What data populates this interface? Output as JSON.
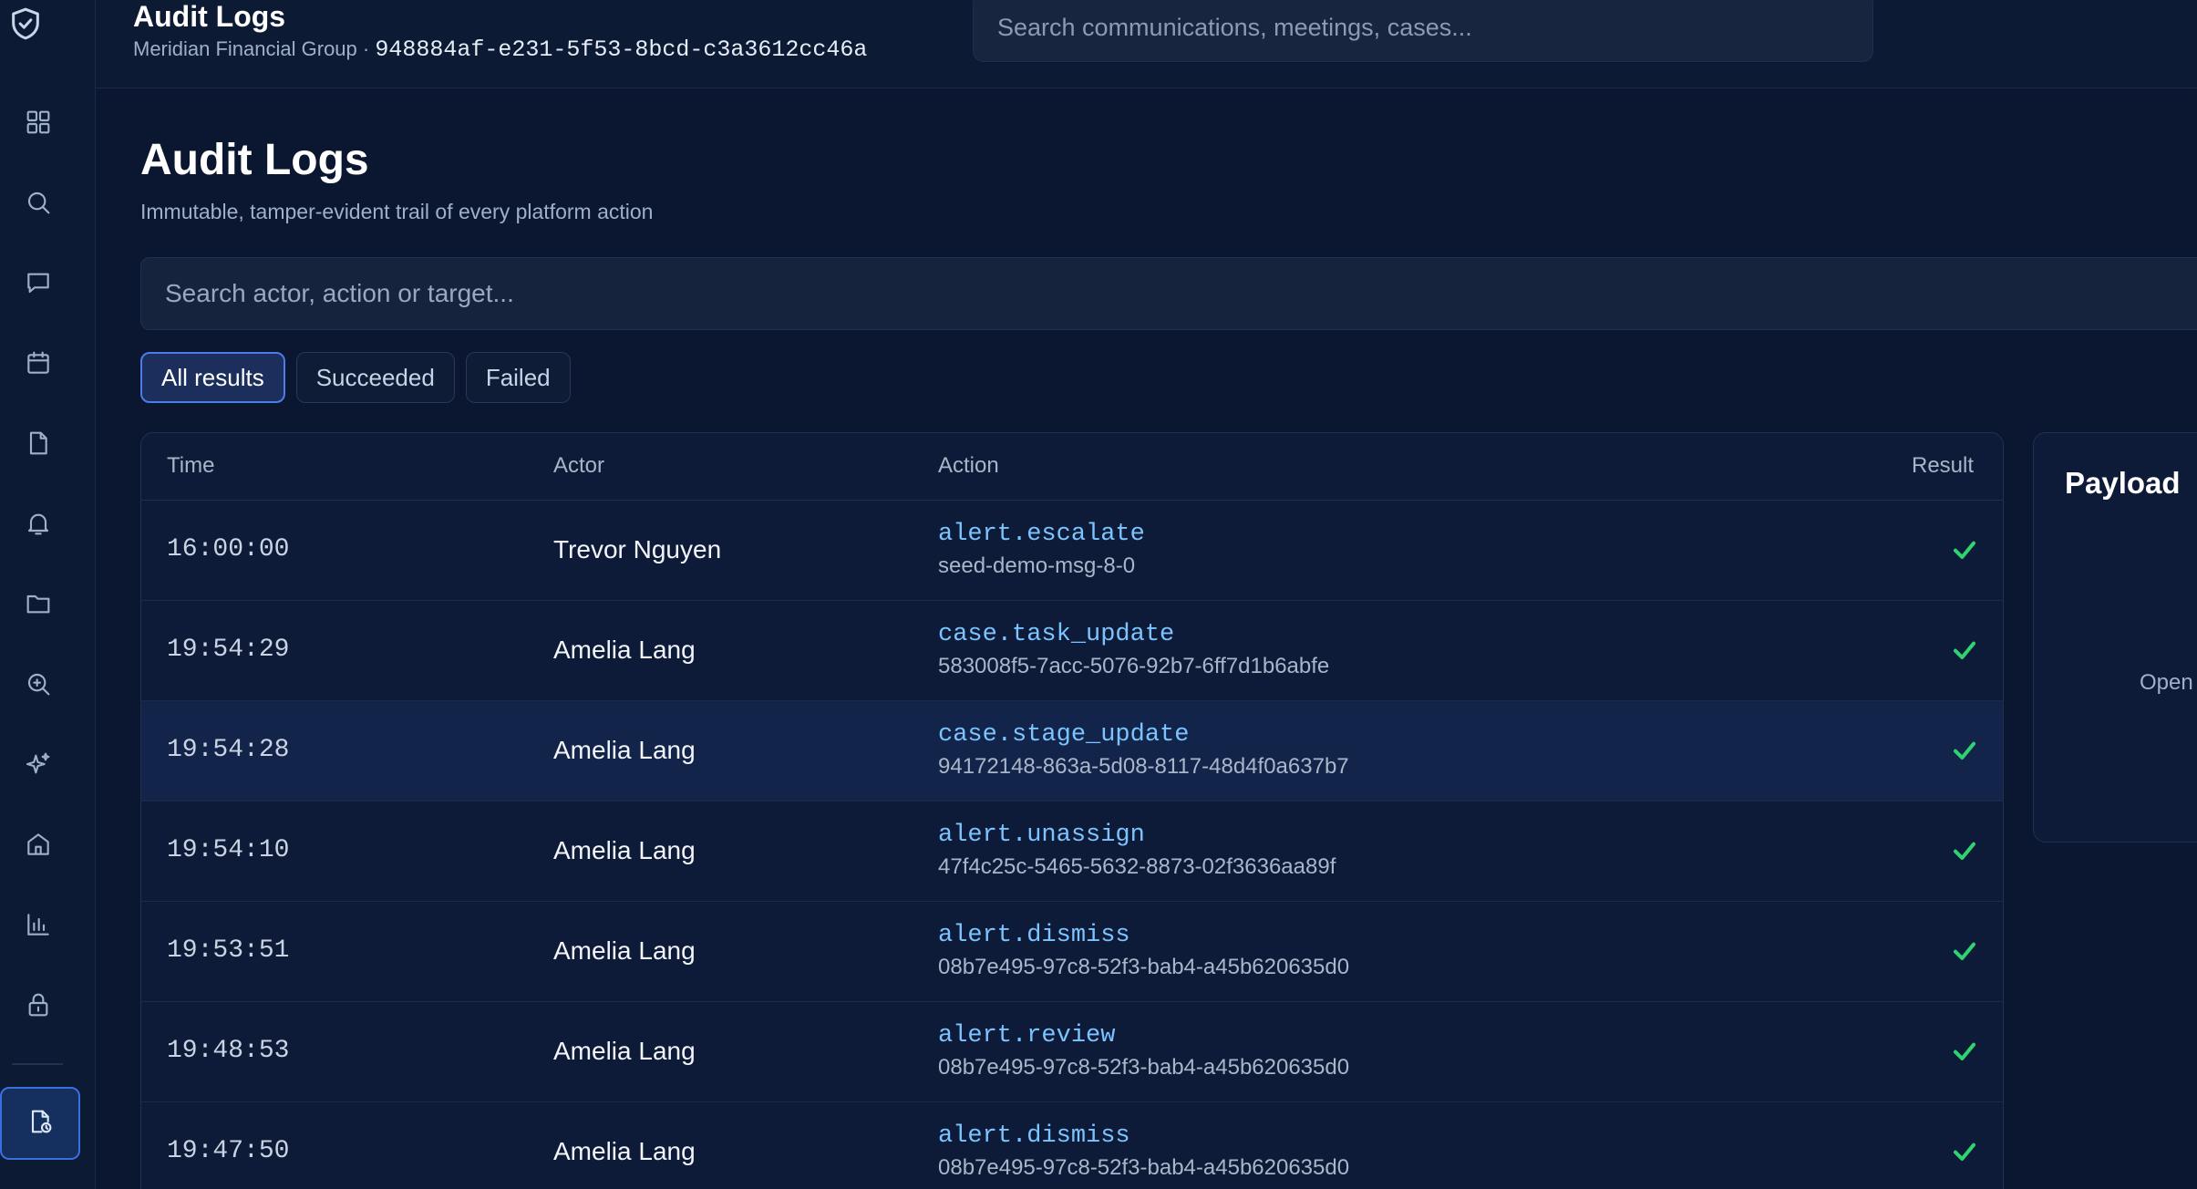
{
  "app": {
    "page_title": "Audit Logs",
    "org_name": "Meridian Financial Group",
    "org_separator": " · ",
    "org_id": "948884af-e231-5f53-8bcd-c3a3612cc46a"
  },
  "top_search": {
    "placeholder": "Search communications, meetings, cases..."
  },
  "sidebar": {
    "logo_icon": "shield-check-icon",
    "items": [
      {
        "icon": "dashboard-grid-icon"
      },
      {
        "icon": "search-icon"
      },
      {
        "icon": "chat-bubble-icon"
      },
      {
        "icon": "calendar-icon"
      },
      {
        "icon": "document-icon"
      },
      {
        "icon": "bell-icon"
      },
      {
        "icon": "folder-icon"
      },
      {
        "icon": "zoom-in-icon"
      },
      {
        "icon": "sparkles-icon"
      },
      {
        "icon": "home-icon"
      },
      {
        "icon": "bar-chart-icon"
      },
      {
        "icon": "lock-icon"
      }
    ],
    "active_item": {
      "icon": "audit-document-icon"
    }
  },
  "main": {
    "title": "Audit Logs",
    "subtitle": "Immutable, tamper-evident trail of every platform action",
    "search_placeholder": "Search actor, action or target...",
    "filters": [
      {
        "label": "All results",
        "active": true
      },
      {
        "label": "Succeeded",
        "active": false
      },
      {
        "label": "Failed",
        "active": false
      }
    ]
  },
  "table": {
    "columns": [
      "Time",
      "Actor",
      "Action",
      "Result"
    ],
    "rows": [
      {
        "time": "16:00:00",
        "actor": "Trevor Nguyen",
        "action": "alert.escalate",
        "target": "seed-demo-msg-8-0",
        "result": "success"
      },
      {
        "time": "19:54:29",
        "actor": "Amelia Lang",
        "action": "case.task_update",
        "target": "583008f5-7acc-5076-92b7-6ff7d1b6abfe",
        "result": "success"
      },
      {
        "time": "19:54:28",
        "actor": "Amelia Lang",
        "action": "case.stage_update",
        "target": "94172148-863a-5d08-8117-48d4f0a637b7",
        "result": "success"
      },
      {
        "time": "19:54:10",
        "actor": "Amelia Lang",
        "action": "alert.unassign",
        "target": "47f4c25c-5465-5632-8873-02f3636aa89f",
        "result": "success"
      },
      {
        "time": "19:53:51",
        "actor": "Amelia Lang",
        "action": "alert.dismiss",
        "target": "08b7e495-97c8-52f3-bab4-a45b620635d0",
        "result": "success"
      },
      {
        "time": "19:48:53",
        "actor": "Amelia Lang",
        "action": "alert.review",
        "target": "08b7e495-97c8-52f3-bab4-a45b620635d0",
        "result": "success"
      },
      {
        "time": "19:47:50",
        "actor": "Amelia Lang",
        "action": "alert.dismiss",
        "target": "08b7e495-97c8-52f3-bab4-a45b620635d0",
        "result": "success"
      }
    ]
  },
  "payload": {
    "title": "Payload",
    "hint": "Open"
  },
  "colors": {
    "background": "#0b1730",
    "accent": "#4a7de8",
    "action_text": "#7cc4ff",
    "success": "#2fd36f"
  }
}
